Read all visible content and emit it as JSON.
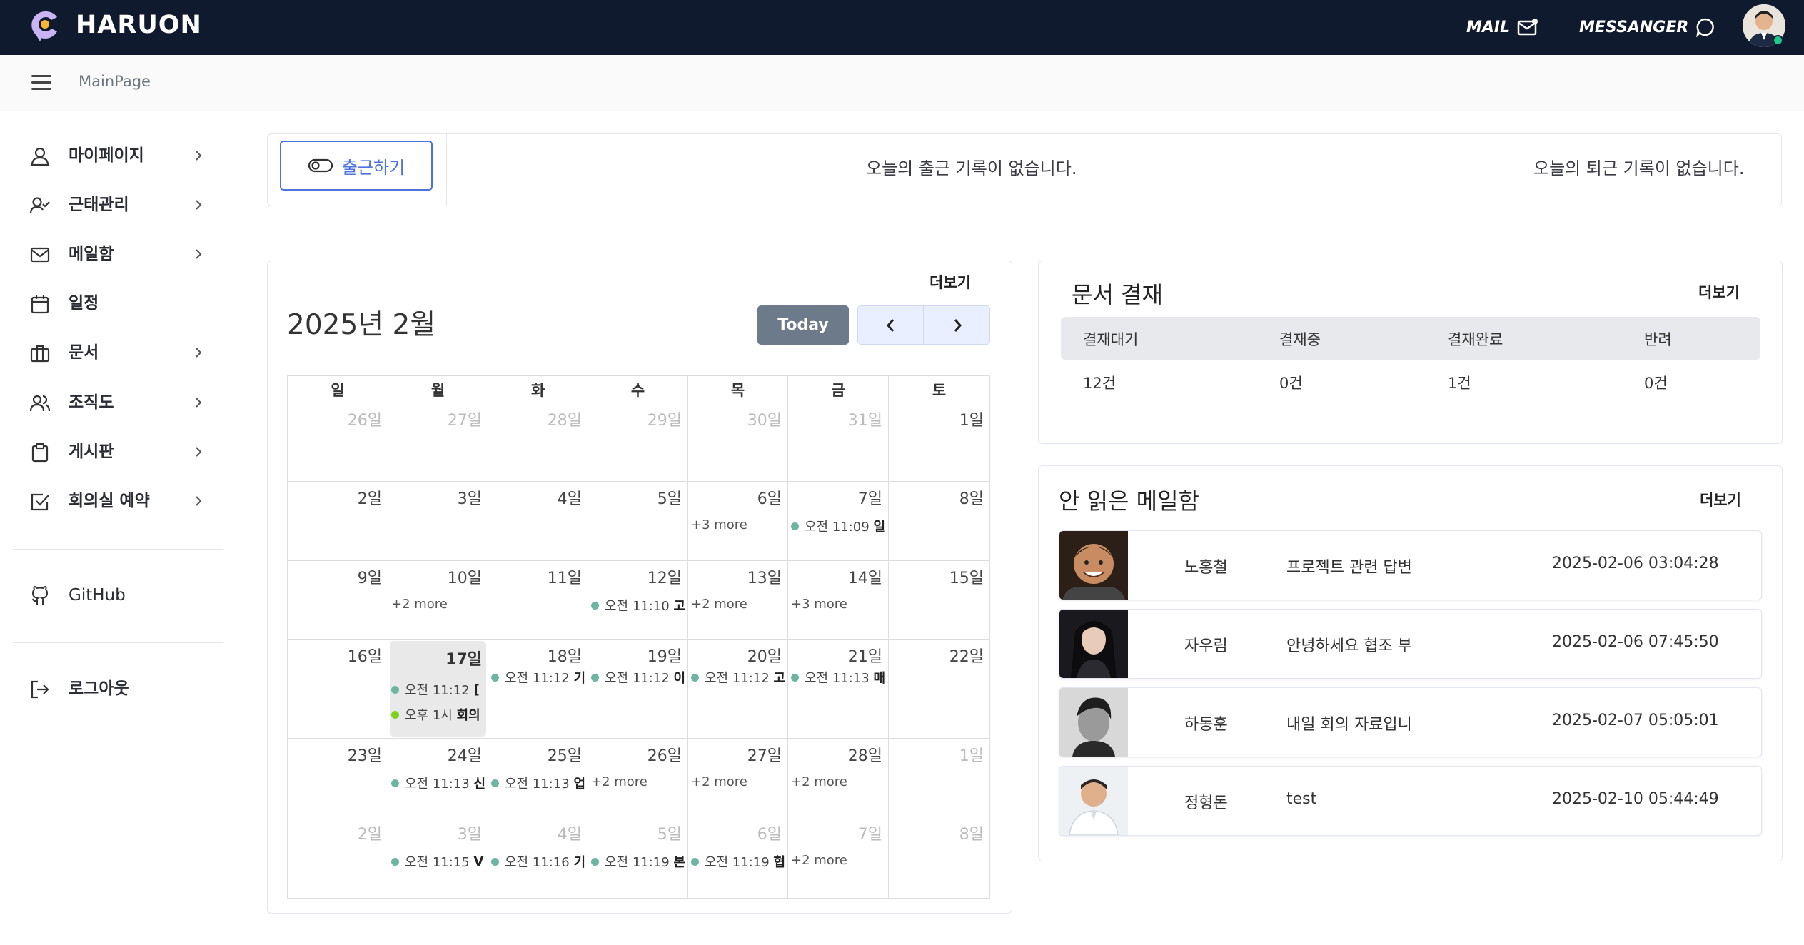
{
  "header": {
    "brand": "HARUON",
    "mail_label": "MAIL",
    "messenger_label": "MESSANGER",
    "colors": {
      "bg": "#101a2e",
      "accent": "#4e73df",
      "online": "#1cc88a"
    }
  },
  "subbar": {
    "breadcrumb": "MainPage"
  },
  "sidebar": {
    "items": [
      {
        "label": "마이페이지",
        "icon": "user-icon"
      },
      {
        "label": "근태관리",
        "icon": "user-check-icon"
      },
      {
        "label": "메일함",
        "icon": "mail-icon"
      },
      {
        "label": "일정",
        "icon": "calendar-icon"
      },
      {
        "label": "문서",
        "icon": "briefcase-icon"
      },
      {
        "label": "조직도",
        "icon": "users-icon"
      },
      {
        "label": "게시판",
        "icon": "clipboard-icon"
      },
      {
        "label": "회의실 예약",
        "icon": "check-square-icon"
      }
    ],
    "github": "GitHub",
    "logout": "로그아웃"
  },
  "attendance": {
    "checkin_button": "출근하기",
    "in_message": "오늘의 출근 기록이 없습니다.",
    "out_message": "오늘의 퇴근 기록이 없습니다."
  },
  "calendar": {
    "more": "더보기",
    "title": "2025년 2월",
    "today_button": "Today",
    "weekdays": [
      "일",
      "월",
      "화",
      "수",
      "목",
      "금",
      "토"
    ],
    "days": [
      "26일",
      "27일",
      "28일",
      "29일",
      "30일",
      "31일",
      "1일",
      "2일",
      "3일",
      "4일",
      "5일",
      "6일",
      "7일",
      "8일",
      "9일",
      "10일",
      "11일",
      "12일",
      "13일",
      "14일",
      "15일",
      "16일",
      "17일",
      "18일",
      "19일",
      "20일",
      "21일",
      "22일",
      "23일",
      "24일",
      "25일",
      "26일",
      "27일",
      "28일",
      "1일",
      "2일",
      "3일",
      "4일",
      "5일",
      "6일",
      "7일",
      "8일"
    ],
    "events": {
      "w1_fri_more": "+3 more",
      "w1_sat_time": "오전 11:09",
      "w1_sat_title": "일",
      "w2_mon_more": "+2 more",
      "w2_wed_time": "오전 11:10",
      "w2_wed_title": "고",
      "w2_thu_more": "+2 more",
      "w2_fri_more": "+3 more",
      "w3_mon_time1": "오전 11:12",
      "w3_mon_title1": "[",
      "w3_mon_time2": "오후 1시",
      "w3_mon_title2": "회의",
      "w3_tue_time": "오전 11:12",
      "w3_tue_title": "기",
      "w3_wed_time": "오전 11:12",
      "w3_wed_title": "이",
      "w3_thu_time": "오전 11:12",
      "w3_thu_title": "고",
      "w3_fri_time": "오전 11:13",
      "w3_fri_title": "매",
      "w4_mon_time": "오전 11:13",
      "w4_mon_title": "신",
      "w4_tue_time": "오전 11:13",
      "w4_tue_title": "업",
      "w4_wed_more": "+2 more",
      "w4_thu_more": "+2 more",
      "w4_fri_more": "+2 more",
      "w5_mon_time": "오전 11:15",
      "w5_mon_title": "V",
      "w5_tue_time": "오전 11:16",
      "w5_tue_title": "기",
      "w5_wed_time": "오전 11:19",
      "w5_wed_title": "본",
      "w5_thu_time": "오전 11:19",
      "w5_thu_title": "협",
      "w5_fri_more": "+2 more"
    }
  },
  "documents": {
    "title": "문서 결재",
    "more": "더보기",
    "headers": [
      "결재대기",
      "결재중",
      "결재완료",
      "반려"
    ],
    "values": [
      "12건",
      "0건",
      "1건",
      "0건"
    ]
  },
  "mailbox": {
    "title": "안 읽은 메일함",
    "more": "더보기",
    "rows": [
      {
        "sender": "노홍철",
        "subject": "프로젝트 관련 답변",
        "date": "2025-02-06 03:04:28"
      },
      {
        "sender": "자우림",
        "subject": "안녕하세요 협조 부",
        "date": "2025-02-06 07:45:50"
      },
      {
        "sender": "하동훈",
        "subject": "내일 회의 자료입니",
        "date": "2025-02-07 05:05:01"
      },
      {
        "sender": "정형돈",
        "subject": "test",
        "date": "2025-02-10 05:44:49"
      }
    ]
  }
}
